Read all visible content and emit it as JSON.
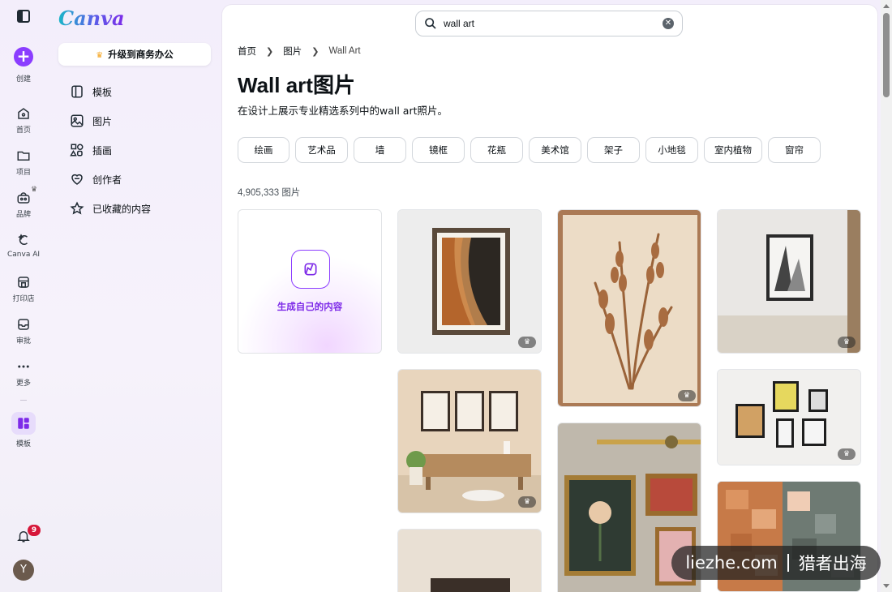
{
  "rail": {
    "create_label": "创建",
    "items": [
      {
        "label": "首页",
        "icon": "home-icon"
      },
      {
        "label": "项目",
        "icon": "folder-icon"
      },
      {
        "label": "品牌",
        "icon": "brand-icon"
      },
      {
        "label": "Canva AI",
        "icon": "canva-ai-icon"
      },
      {
        "label": "打印店",
        "icon": "print-shop-icon"
      },
      {
        "label": "审批",
        "icon": "inbox-icon"
      },
      {
        "label": "更多",
        "icon": "more-icon"
      },
      {
        "label": "模板",
        "icon": "templates-icon"
      }
    ],
    "notification_count": "9",
    "avatar_initial": "Y"
  },
  "sidebar": {
    "logo": "Canva",
    "upgrade_label": "升级到商务办公",
    "items": [
      {
        "label": "模板",
        "icon": "template-icon"
      },
      {
        "label": "图片",
        "icon": "image-icon"
      },
      {
        "label": "插画",
        "icon": "shapes-icon"
      },
      {
        "label": "创作者",
        "icon": "heart-icon"
      },
      {
        "label": "已收藏的内容",
        "icon": "star-icon"
      }
    ]
  },
  "search": {
    "value": "wall art"
  },
  "breadcrumb": {
    "home": "首页",
    "section": "图片",
    "current": "Wall Art"
  },
  "page": {
    "title": "Wall art图片",
    "subtitle": "在设计上展示专业精选系列中的wall art照片。",
    "result_count": "4,905,333 图片"
  },
  "chips": [
    "绘画",
    "艺术品",
    "墙",
    "镜框",
    "花瓶",
    "美术馆",
    "架子",
    "小地毯",
    "室内植物",
    "窗帘"
  ],
  "generate": {
    "label": "生成自己的内容"
  },
  "watermark": {
    "left": "liezhe.com",
    "right": "猎者出海"
  },
  "colors": {
    "accent": "#8b3dff",
    "badge": "#d6173a"
  }
}
